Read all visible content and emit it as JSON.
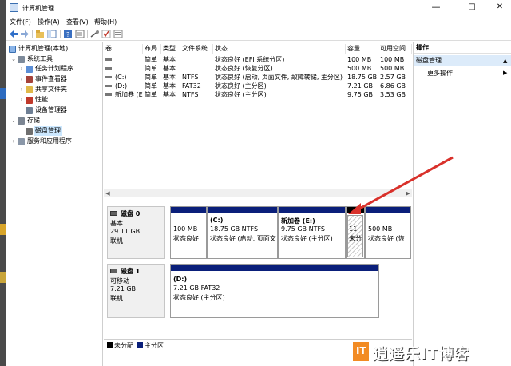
{
  "window": {
    "title": "计算机管理",
    "minimize": "—",
    "maximize": "□",
    "close": "✕"
  },
  "menu": [
    "文件(F)",
    "操作(A)",
    "查看(V)",
    "帮助(H)"
  ],
  "tree": {
    "root": "计算机管理(本地)",
    "system_tools": "系统工具",
    "task_scheduler": "任务计划程序",
    "event_viewer": "事件查看器",
    "shared_folders": "共享文件夹",
    "performance": "性能",
    "device_manager": "设备管理器",
    "storage": "存储",
    "disk_management": "磁盘管理",
    "services_apps": "服务和应用程序"
  },
  "volume_table": {
    "headers": [
      "卷",
      "布局",
      "类型",
      "文件系统",
      "状态",
      "容量",
      "可用空间"
    ],
    "rows": [
      [
        "",
        "简单",
        "基本",
        "",
        "状态良好 (EFI 系统分区)",
        "100 MB",
        "100 MB"
      ],
      [
        "",
        "简单",
        "基本",
        "",
        "状态良好 (恢复分区)",
        "500 MB",
        "500 MB"
      ],
      [
        "(C:)",
        "简单",
        "基本",
        "NTFS",
        "状态良好 (启动, 页面文件, 故障转储, 主分区)",
        "18.75 GB",
        "2.57 GB"
      ],
      [
        "(D:)",
        "简单",
        "基本",
        "FAT32",
        "状态良好 (主分区)",
        "7.21 GB",
        "6.86 GB"
      ],
      [
        "新加卷 (E:)",
        "简单",
        "基本",
        "NTFS",
        "状态良好 (主分区)",
        "9.75 GB",
        "3.53 GB"
      ]
    ]
  },
  "disks": [
    {
      "name": "磁盘 0",
      "type": "基本",
      "size": "29.11 GB",
      "status": "联机",
      "partitions": [
        {
          "title": "",
          "size": "100 MB",
          "status": "状态良好"
        },
        {
          "title": "(C:)",
          "size": "18.75 GB NTFS",
          "status": "状态良好 (启动, 页面文"
        },
        {
          "title": "新加卷  (E:)",
          "size": "9.75 GB NTFS",
          "status": "状态良好 (主分区)"
        },
        {
          "title": "",
          "size": "11 ",
          "status": "未分"
        },
        {
          "title": "",
          "size": "500 MB",
          "status": "状态良好 (恢"
        }
      ]
    },
    {
      "name": "磁盘 1",
      "type": "可移动",
      "size": "7.21 GB",
      "status": "联机",
      "partitions": [
        {
          "title": "(D:)",
          "size": "7.21 GB FAT32",
          "status": "状态良好 (主分区)"
        }
      ]
    }
  ],
  "legend": {
    "unallocated": "未分配",
    "primary": "主分区"
  },
  "actions": {
    "header": "操作",
    "section": "磁盘管理",
    "more": "更多操作"
  },
  "watermark": {
    "logo": "IT",
    "text": "逍遥乐IT博客"
  },
  "colors": {
    "primary_partition": "#0a1f7a",
    "unallocated": "#000000",
    "arrow": "#d9312b",
    "selection": "#cce8ff"
  }
}
